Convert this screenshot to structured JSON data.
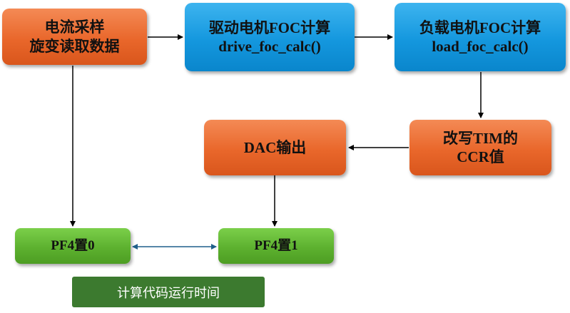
{
  "nodes": {
    "sampling": {
      "line1": "电流采样",
      "line2": "旋变读取数据"
    },
    "drive_foc": {
      "line1": "驱动电机FOC计算",
      "line2": "drive_foc_calc()"
    },
    "load_foc": {
      "line1": "负载电机FOC计算",
      "line2": "load_foc_calc()"
    },
    "write_ccr": {
      "line1": "改写TIM的",
      "line2": "CCR值"
    },
    "dac_output": {
      "line1": "DAC输出"
    },
    "pf4_low": {
      "line1": "PF4置0"
    },
    "pf4_high": {
      "line1": "PF4置1"
    }
  },
  "caption": {
    "text": "计算代码运行时间"
  },
  "colors": {
    "orange": "#e9672b",
    "blue": "#1497de",
    "green": "#5db12f",
    "caption_bg": "#3c7a2f",
    "arrow": "#000000",
    "double_arrow": "#1f5f8b"
  }
}
